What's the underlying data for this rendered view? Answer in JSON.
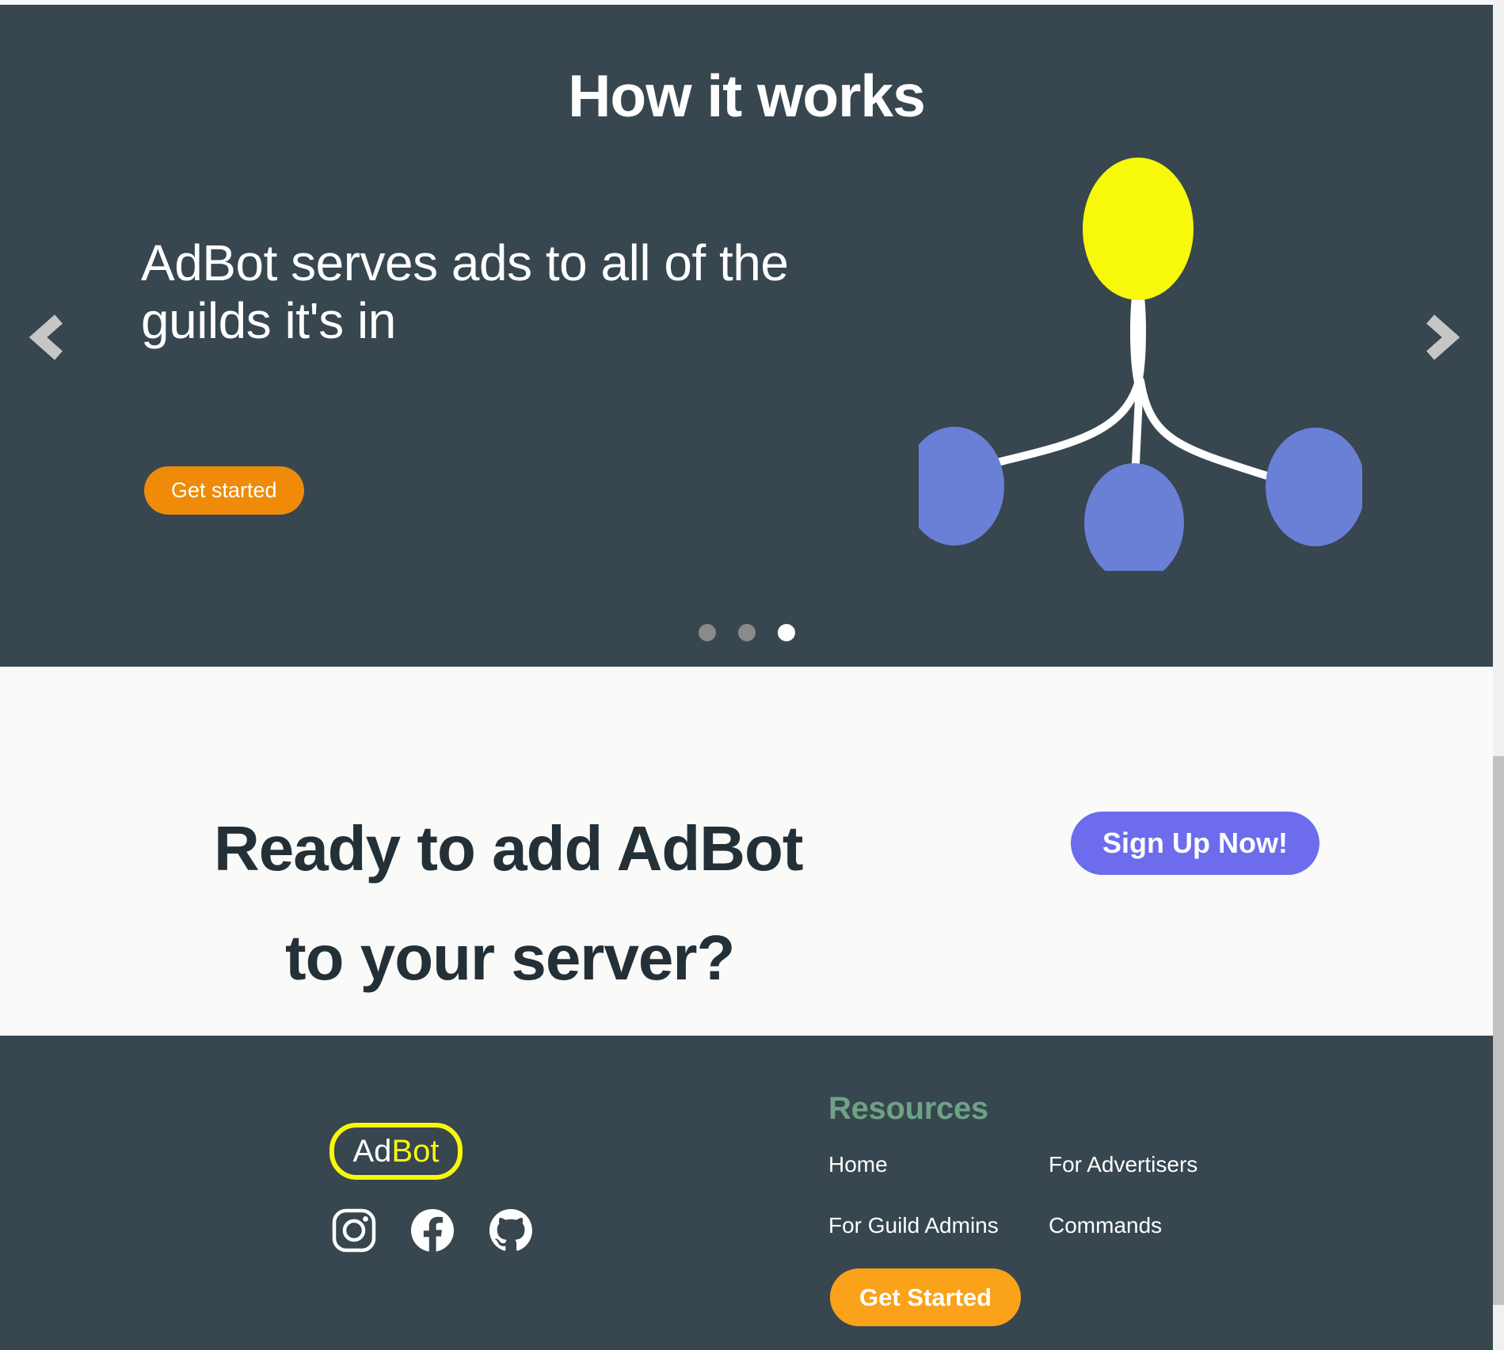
{
  "hero": {
    "title": "How it works",
    "slide": {
      "text": "AdBot serves ads to all of the guilds it's in",
      "cta_label": "Get started"
    },
    "carousel": {
      "prev_label": "‹",
      "next_label": "›",
      "dots": [
        {
          "active": false
        },
        {
          "active": false
        },
        {
          "active": true
        }
      ],
      "active_index": 3,
      "total_slides": 3
    },
    "illustration": {
      "name": "adbot-guilds-diagram",
      "hub_color": "#f8f80a",
      "node_color": "#6a80d6",
      "link_color": "#ffffff",
      "node_count": 3
    },
    "background_color": "#37464f"
  },
  "cta": {
    "heading_line1": "Ready to add AdBot",
    "heading_line2": "to your server?",
    "signup_label": "Sign Up Now!",
    "signup_color": "#6c6ced",
    "background_color": "#fafaf8"
  },
  "footer": {
    "logo": {
      "prefix": "Ad",
      "suffix": "Bot"
    },
    "socials": [
      {
        "name": "instagram-icon",
        "label": "Instagram"
      },
      {
        "name": "facebook-icon",
        "label": "Facebook"
      },
      {
        "name": "github-icon",
        "label": "GitHub"
      }
    ],
    "resources_title": "Resources",
    "resources_title_color": "#6ea286",
    "links": [
      {
        "label": "Home"
      },
      {
        "label": "For Advertisers"
      },
      {
        "label": "For Guild Admins"
      },
      {
        "label": "Commands"
      }
    ],
    "get_started_label": "Get Started",
    "get_started_color": "#f9a21a",
    "background_color": "#37464f"
  },
  "window": {
    "scrollbar_thumb_color": "#c1c1c1",
    "scrollbar_track_color": "#f0f0f0"
  }
}
